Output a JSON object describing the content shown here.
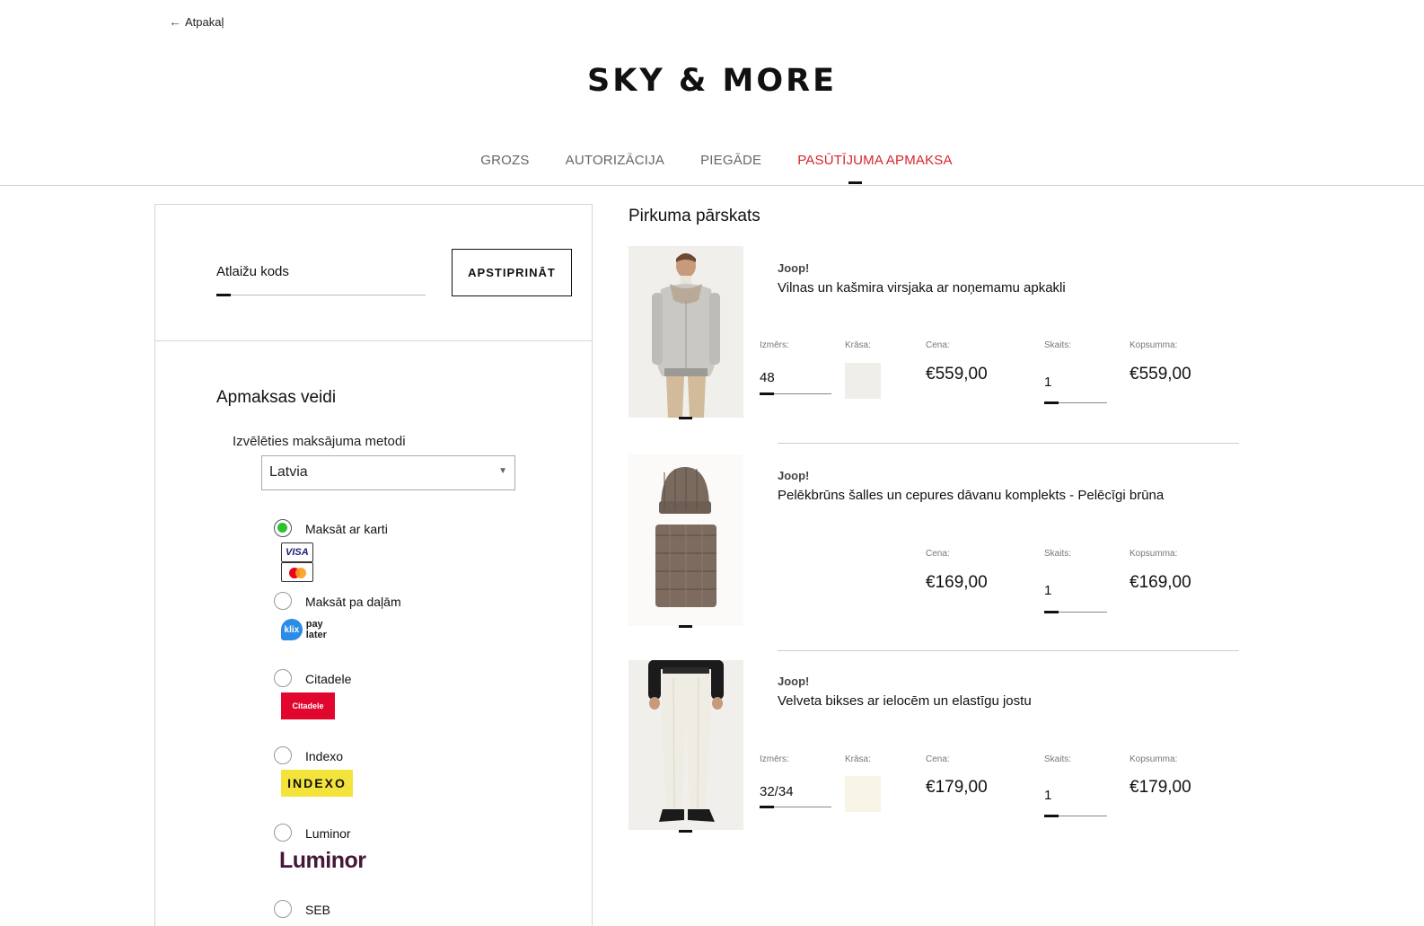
{
  "header": {
    "back_label": "Atpakaļ",
    "logo": "SKY & MORE"
  },
  "steps": [
    {
      "label": "GROZS",
      "active": false
    },
    {
      "label": "AUTORIZĀCIJA",
      "active": false
    },
    {
      "label": "PIEGĀDE",
      "active": false
    },
    {
      "label": "PASŪTĪJUMA APMAKSA",
      "active": true
    }
  ],
  "coupon": {
    "label": "Atlaižu kods",
    "button": "APSTIPRINĀT"
  },
  "payment": {
    "title": "Apmaksas veidi",
    "select_label": "Izvēlēties maksājuma metodi",
    "country": "Latvia",
    "methods": [
      {
        "label": "Maksāt ar karti",
        "selected": true,
        "logos": [
          "VISA",
          "mastercard"
        ]
      },
      {
        "label": "Maksāt pa daļām",
        "selected": false,
        "logos": [
          "klix",
          "pay later"
        ]
      },
      {
        "label": "Citadele",
        "selected": false,
        "logos": [
          "Citadele"
        ]
      },
      {
        "label": "Indexo",
        "selected": false,
        "logos": [
          "INDEXO"
        ]
      },
      {
        "label": "Luminor",
        "selected": false,
        "logos": [
          "Luminor"
        ]
      },
      {
        "label": "SEB",
        "selected": false,
        "logos": []
      }
    ]
  },
  "summary": {
    "title": "Pirkuma pārskats",
    "labels": {
      "size": "Izmērs:",
      "color": "Krāsa:",
      "price": "Cena:",
      "qty": "Skaits:",
      "total": "Kopsumma:"
    },
    "items": [
      {
        "brand": "Joop!",
        "name": "Vilnas un kašmira virsjaka ar noņemamu apkakli",
        "size": "48",
        "color": "#f0eeea",
        "price": "€559,00",
        "qty": "1",
        "total": "€559,00"
      },
      {
        "brand": "Joop!",
        "name": "Pelēkbrūns šalles un cepures dāvanu komplekts - Pelēcīgi brūna",
        "price": "€169,00",
        "qty": "1",
        "total": "€169,00"
      },
      {
        "brand": "Joop!",
        "name": "Velveta bikses ar ielocēm un elastīgu jostu",
        "size": "32/34",
        "color": "#f8f5e6",
        "price": "€179,00",
        "qty": "1",
        "total": "€179,00"
      }
    ]
  }
}
